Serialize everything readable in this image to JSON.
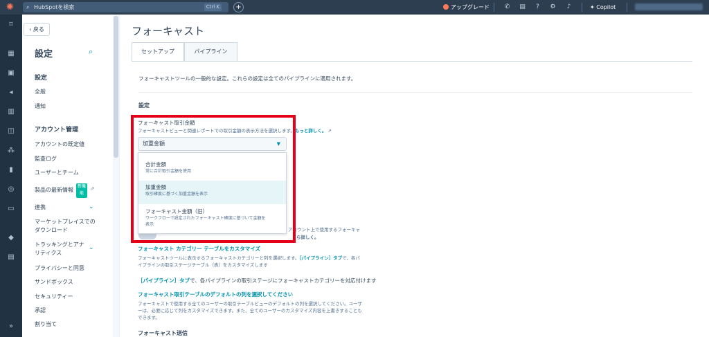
{
  "topbar": {
    "search_placeholder": "HubSpotを検索",
    "shortcut_ctrl": "Ctrl",
    "shortcut_key": "K",
    "upgrade": "アップグレード",
    "copilot": "Copilot"
  },
  "sidebar": {
    "back": "戻る",
    "title": "設定",
    "section1": "設定",
    "general": "全般",
    "notifications": "通知",
    "account_mgmt": "アカウント管理",
    "account_defaults": "アカウントの既定値",
    "audit_log": "監査ログ",
    "users_teams": "ユーザーとチーム",
    "product_updates": "製品の最新情報",
    "new_badge": "新機能",
    "integrations": "連携",
    "marketplace_line1": "マーケットプレイスでの",
    "marketplace_line2": "ダウンロード",
    "tracking_line1": "トラッキングとアナ",
    "tracking_line2": "リティクス",
    "privacy": "プライバシーと同意",
    "sandbox": "サンドボックス",
    "security": "セキュリティー",
    "approvals": "承認",
    "assignments": "割り当て"
  },
  "page": {
    "title": "フォーキャスト",
    "tabs": [
      "セットアップ",
      "パイプライン"
    ],
    "intro": "フォーキャストツールの一般的な設定。これらの設定は全てのパイプラインに適用されます。",
    "settings_heading": "設定",
    "amount_label": "フォーキャスト取引金額",
    "amount_desc": "フォーキャストビューと関連レポートでの取引金額の表示方法を選択します。",
    "amount_more": "もっと詳しく。",
    "selected": "加重金額",
    "options": [
      {
        "label": "合計金額",
        "desc": "常に合計取引金額を使用"
      },
      {
        "label": "加重金額",
        "desc": "取引確度に基づく加重金額を表示"
      },
      {
        "label": "フォーキャスト金額（旧）",
        "desc1": "ワークフローで設定されたフォーキャスト確度に基づいて金額を",
        "desc2": "表示"
      }
    ],
    "behind_line1": "アカウント上で使用するフォーキャ",
    "behind_more": "ら詳しく。",
    "category_title": "フォーキャスト カテゴリー テーブルをカスタマイズ",
    "category_desc1_a": "フォーキャストツールに表示するフォーキャストカテゴリーと列を選択します。",
    "category_desc1_link": "［パイプライン］タブ",
    "category_desc1_b": "で、各パ",
    "category_desc2": "イプラインの取引ステージテーブル（表）をカスタマイズします",
    "pipeline_tab_link": "［パイプライン］タブ",
    "pipeline_tab_text": "で、各パイプラインの取引ステージにフォーキャストカテゴリーを対応付けます",
    "default_cols_title": "フォーキャスト取引テーブルのデフォルトの列を選択してください",
    "default_cols_desc1": "フォーキャストで使用する全てのユーザーの取引テーブルビューのデフォルトの列を選択してください。ユーザ",
    "default_cols_desc2": "ーは、必要に応じて列をカスタマイズできます。また、全てのユーザーのカスタマイズ内容を上書きすることも",
    "default_cols_desc3": "できます。",
    "submit_heading": "フォーキャスト送信"
  }
}
